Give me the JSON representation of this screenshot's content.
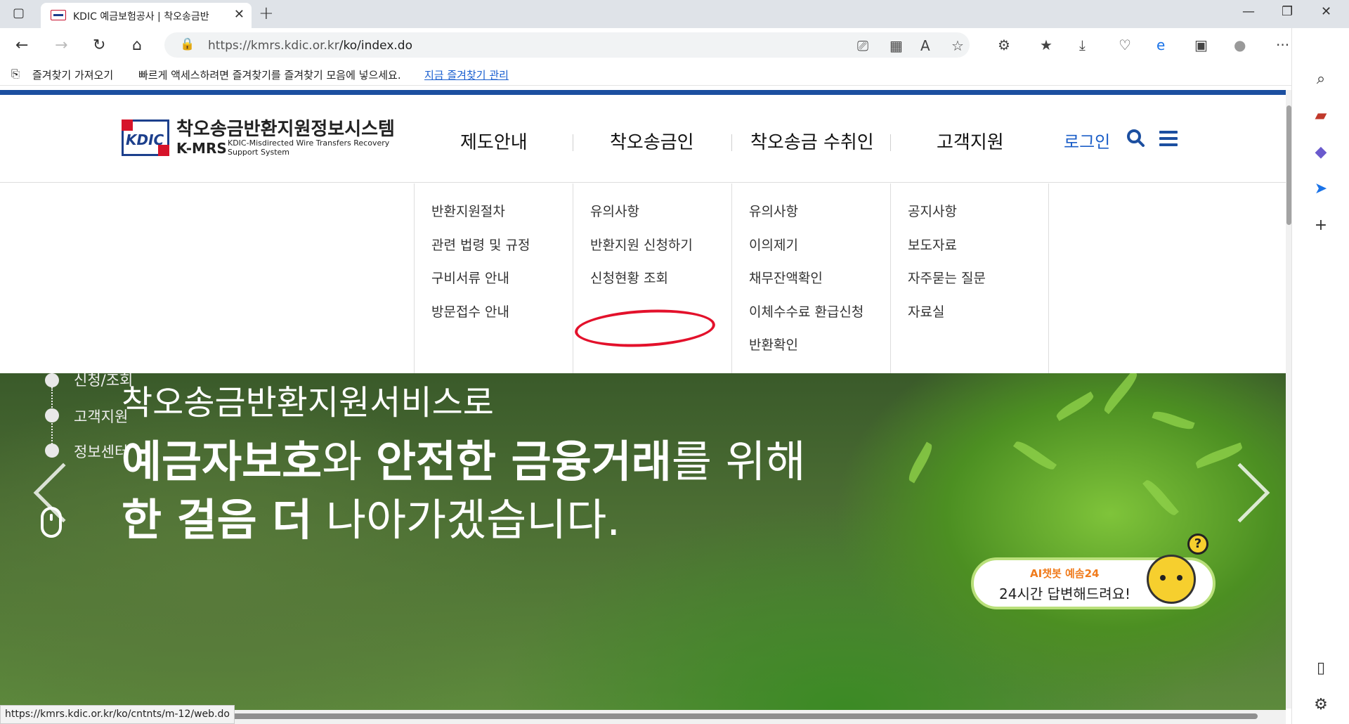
{
  "browser": {
    "tab_title": "KDIC 예금보험공사 | 착오송금반",
    "url_host": "https://kmrs.kdic.or.kr",
    "url_path": "/ko/index.do",
    "favorites_import": "즐겨찾기 가져오기",
    "favorites_hint": "빠르게 액세스하려면 즐겨찾기를 즐겨찾기 모음에 넣으세요.",
    "favorites_manage": "지금 즐겨찾기 관리",
    "status_url": "https://kmrs.kdic.or.kr/ko/cntnts/m-12/web.do"
  },
  "site": {
    "logo_box": "KDIC",
    "logo_ko": "착오송금반환지원정보시스템",
    "logo_en": "K-MRS",
    "logo_en_sub1": "KDIC-Misdirected Wire Transfers Recovery",
    "logo_en_sub2": "Support System",
    "gnb": [
      "제도안내",
      "착오송금인",
      "착오송금 수취인",
      "고객지원"
    ],
    "login": "로그인",
    "dropdown": [
      [
        "반환지원절차",
        "관련 법령 및 규정",
        "구비서류 안내",
        "방문접수 안내"
      ],
      [
        "유의사항",
        "반환지원 신청하기",
        "신청현황 조회"
      ],
      [
        "유의사항",
        "이의제기",
        "채무잔액확인",
        "이체수수료 환급신청",
        "반환확인"
      ],
      [
        "공지사항",
        "보도자료",
        "자주묻는 질문",
        "자료실"
      ]
    ],
    "side_nav": [
      "신청/조회",
      "고객지원",
      "정보센터"
    ],
    "hero_line1": "착오송금반환지원서비스로",
    "hero_line2_bold1": "예금자보호",
    "hero_line2_mid": "와 ",
    "hero_line2_bold2": "안전한 금융거래",
    "hero_line2_end": "를 위해",
    "hero_line3_bold": "한 걸음 더",
    "hero_line3_end": " 나아가겠습니다.",
    "chatbot_title": "AI챗봇 예솜24",
    "chatbot_text": "24시간 답변해드려요!",
    "chatbot_q": "?"
  },
  "colors": {
    "brand_blue": "#1c4fa0",
    "brand_red": "#d6132a",
    "login_blue": "#1c5fc8",
    "highlight_circle": "#e3112b"
  }
}
